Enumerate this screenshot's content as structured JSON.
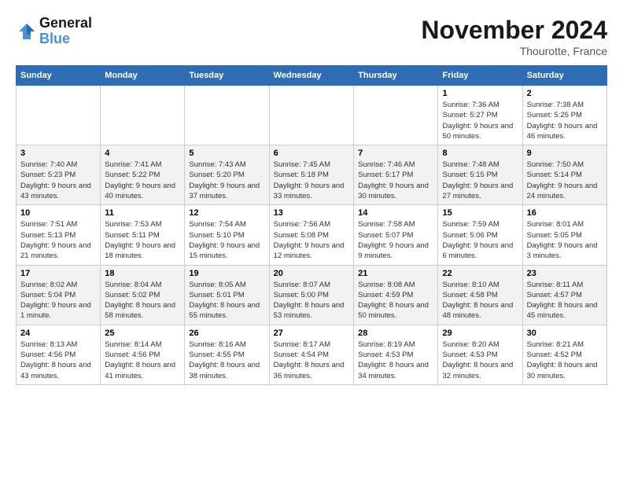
{
  "header": {
    "logo_line1": "General",
    "logo_line2": "Blue",
    "month_title": "November 2024",
    "location": "Thourotte, France"
  },
  "weekdays": [
    "Sunday",
    "Monday",
    "Tuesday",
    "Wednesday",
    "Thursday",
    "Friday",
    "Saturday"
  ],
  "weeks": [
    [
      {
        "day": "",
        "info": ""
      },
      {
        "day": "",
        "info": ""
      },
      {
        "day": "",
        "info": ""
      },
      {
        "day": "",
        "info": ""
      },
      {
        "day": "",
        "info": ""
      },
      {
        "day": "1",
        "info": "Sunrise: 7:36 AM\nSunset: 5:27 PM\nDaylight: 9 hours and 50 minutes."
      },
      {
        "day": "2",
        "info": "Sunrise: 7:38 AM\nSunset: 5:25 PM\nDaylight: 9 hours and 46 minutes."
      }
    ],
    [
      {
        "day": "3",
        "info": "Sunrise: 7:40 AM\nSunset: 5:23 PM\nDaylight: 9 hours and 43 minutes."
      },
      {
        "day": "4",
        "info": "Sunrise: 7:41 AM\nSunset: 5:22 PM\nDaylight: 9 hours and 40 minutes."
      },
      {
        "day": "5",
        "info": "Sunrise: 7:43 AM\nSunset: 5:20 PM\nDaylight: 9 hours and 37 minutes."
      },
      {
        "day": "6",
        "info": "Sunrise: 7:45 AM\nSunset: 5:18 PM\nDaylight: 9 hours and 33 minutes."
      },
      {
        "day": "7",
        "info": "Sunrise: 7:46 AM\nSunset: 5:17 PM\nDaylight: 9 hours and 30 minutes."
      },
      {
        "day": "8",
        "info": "Sunrise: 7:48 AM\nSunset: 5:15 PM\nDaylight: 9 hours and 27 minutes."
      },
      {
        "day": "9",
        "info": "Sunrise: 7:50 AM\nSunset: 5:14 PM\nDaylight: 9 hours and 24 minutes."
      }
    ],
    [
      {
        "day": "10",
        "info": "Sunrise: 7:51 AM\nSunset: 5:13 PM\nDaylight: 9 hours and 21 minutes."
      },
      {
        "day": "11",
        "info": "Sunrise: 7:53 AM\nSunset: 5:11 PM\nDaylight: 9 hours and 18 minutes."
      },
      {
        "day": "12",
        "info": "Sunrise: 7:54 AM\nSunset: 5:10 PM\nDaylight: 9 hours and 15 minutes."
      },
      {
        "day": "13",
        "info": "Sunrise: 7:56 AM\nSunset: 5:08 PM\nDaylight: 9 hours and 12 minutes."
      },
      {
        "day": "14",
        "info": "Sunrise: 7:58 AM\nSunset: 5:07 PM\nDaylight: 9 hours and 9 minutes."
      },
      {
        "day": "15",
        "info": "Sunrise: 7:59 AM\nSunset: 5:06 PM\nDaylight: 9 hours and 6 minutes."
      },
      {
        "day": "16",
        "info": "Sunrise: 8:01 AM\nSunset: 5:05 PM\nDaylight: 9 hours and 3 minutes."
      }
    ],
    [
      {
        "day": "17",
        "info": "Sunrise: 8:02 AM\nSunset: 5:04 PM\nDaylight: 9 hours and 1 minute."
      },
      {
        "day": "18",
        "info": "Sunrise: 8:04 AM\nSunset: 5:02 PM\nDaylight: 8 hours and 58 minutes."
      },
      {
        "day": "19",
        "info": "Sunrise: 8:05 AM\nSunset: 5:01 PM\nDaylight: 8 hours and 55 minutes."
      },
      {
        "day": "20",
        "info": "Sunrise: 8:07 AM\nSunset: 5:00 PM\nDaylight: 8 hours and 53 minutes."
      },
      {
        "day": "21",
        "info": "Sunrise: 8:08 AM\nSunset: 4:59 PM\nDaylight: 8 hours and 50 minutes."
      },
      {
        "day": "22",
        "info": "Sunrise: 8:10 AM\nSunset: 4:58 PM\nDaylight: 8 hours and 48 minutes."
      },
      {
        "day": "23",
        "info": "Sunrise: 8:11 AM\nSunset: 4:57 PM\nDaylight: 8 hours and 45 minutes."
      }
    ],
    [
      {
        "day": "24",
        "info": "Sunrise: 8:13 AM\nSunset: 4:56 PM\nDaylight: 8 hours and 43 minutes."
      },
      {
        "day": "25",
        "info": "Sunrise: 8:14 AM\nSunset: 4:56 PM\nDaylight: 8 hours and 41 minutes."
      },
      {
        "day": "26",
        "info": "Sunrise: 8:16 AM\nSunset: 4:55 PM\nDaylight: 8 hours and 38 minutes."
      },
      {
        "day": "27",
        "info": "Sunrise: 8:17 AM\nSunset: 4:54 PM\nDaylight: 8 hours and 36 minutes."
      },
      {
        "day": "28",
        "info": "Sunrise: 8:19 AM\nSunset: 4:53 PM\nDaylight: 8 hours and 34 minutes."
      },
      {
        "day": "29",
        "info": "Sunrise: 8:20 AM\nSunset: 4:53 PM\nDaylight: 8 hours and 32 minutes."
      },
      {
        "day": "30",
        "info": "Sunrise: 8:21 AM\nSunset: 4:52 PM\nDaylight: 8 hours and 30 minutes."
      }
    ]
  ]
}
